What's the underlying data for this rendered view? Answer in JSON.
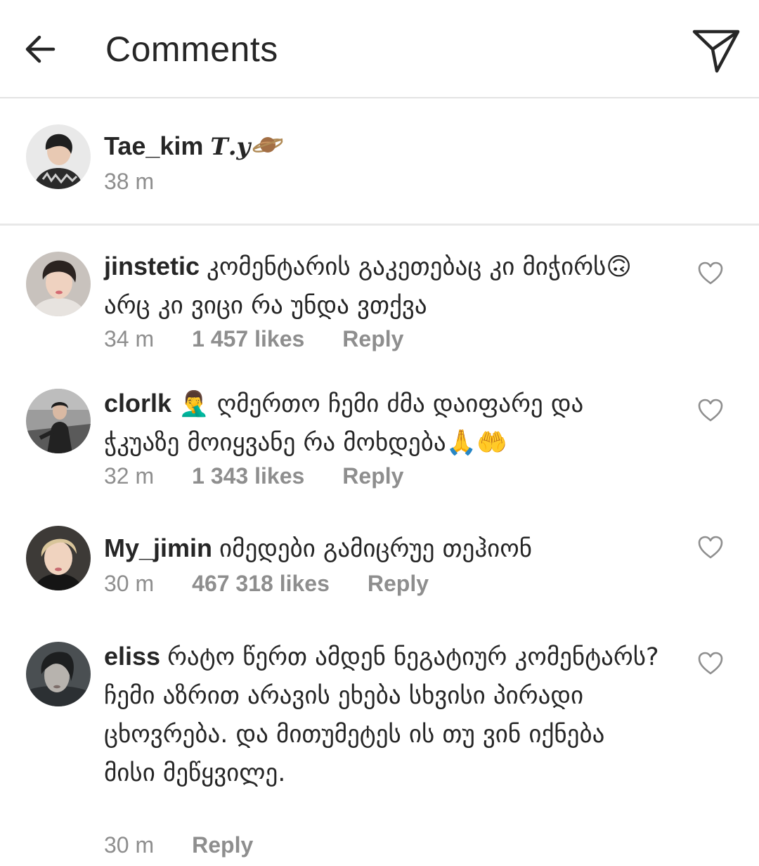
{
  "header": {
    "title": "Comments",
    "back_icon": "back-arrow-icon",
    "send_icon": "send-icon"
  },
  "caption": {
    "username": "Tae_kim",
    "flair": "𝑻.𝒚",
    "time": "38 m"
  },
  "comments": [
    {
      "username": "jinstetic",
      "text": "კომენტარის გაკეთებაც კი მიჭირს🙃 არც კი ვიცი რა უნდა ვთქვა",
      "time": "34 m",
      "likes": "1 457 likes",
      "reply": "Reply"
    },
    {
      "username": "clorlk",
      "text": "🤦‍♂️ ღმერთო ჩემი ძმა დაიფარე და ჭკუაზე მოიყვანე რა მოხდება🙏🤲",
      "time": "32 m",
      "likes": "1 343 likes",
      "reply": "Reply"
    },
    {
      "username": "My_jimin",
      "text": "იმედები გამიცრუე თეჰიონ",
      "time": "30 m",
      "likes": "467 318 likes",
      "reply": "Reply"
    },
    {
      "username": "eliss",
      "text": "რატო წერთ ამდენ ნეგატიურ კომენტარს? ჩემი აზრით არავის ეხება სხვისი პირადი ცხოვრება. და მითუმეტეს ის თუ ვინ იქნება მისი მეწყვილე.",
      "time": "30 m",
      "reply": "Reply"
    }
  ]
}
